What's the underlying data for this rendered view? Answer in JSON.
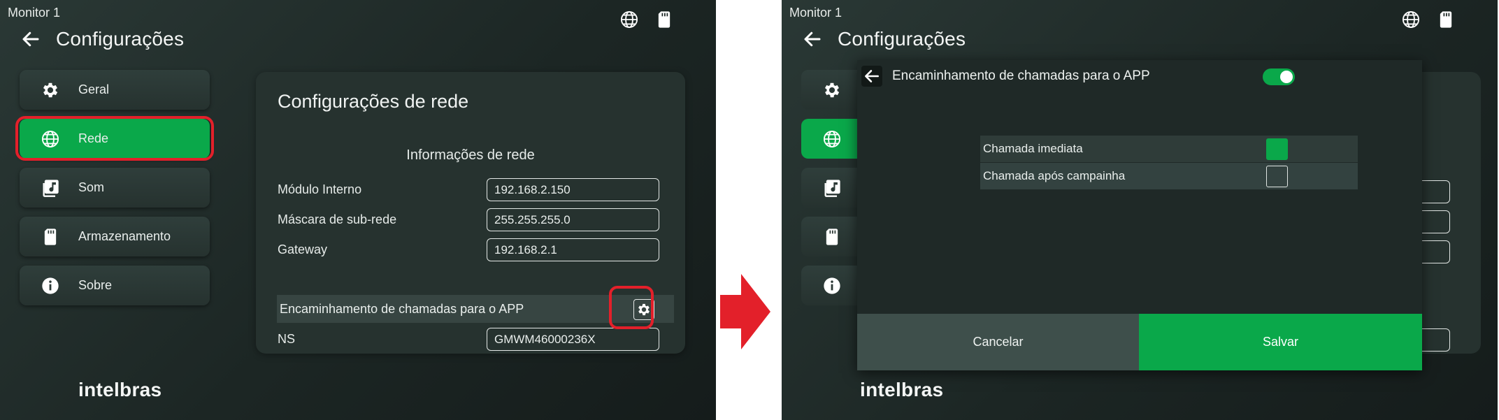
{
  "monitor_label": "Monitor 1",
  "page_title": "Configurações",
  "logo_text": "intelbras",
  "sidebar": {
    "items": [
      {
        "label": "Geral",
        "icon": "gear-icon"
      },
      {
        "label": "Rede",
        "icon": "globe-icon"
      },
      {
        "label": "Som",
        "icon": "music-icon"
      },
      {
        "label": "Armazenamento",
        "icon": "sd-card-icon"
      },
      {
        "label": "Sobre",
        "icon": "info-icon"
      }
    ],
    "active_index": 1
  },
  "network_panel": {
    "title": "Configurações de rede",
    "subtitle": "Informações de rede",
    "fields": [
      {
        "label": "Módulo Interno",
        "value": "192.168.2.150"
      },
      {
        "label": "Máscara de sub-rede",
        "value": "255.255.255.0"
      },
      {
        "label": "Gateway",
        "value": "192.168.2.1"
      }
    ],
    "forwarding_label": "Encaminhamento de chamadas para o APP",
    "ns_label": "NS",
    "ns_value": "GMWM46000236X"
  },
  "modal": {
    "title": "Encaminhamento de chamadas para o APP",
    "toggle_on": true,
    "options": [
      {
        "label": "Chamada imediata",
        "checked": true
      },
      {
        "label": "Chamada após campainha",
        "checked": false
      }
    ],
    "cancel_label": "Cancelar",
    "save_label": "Salvar"
  },
  "colors": {
    "accent_green": "#0aa84a",
    "highlight_red": "#e3202a",
    "background_dark": "#1c2624"
  }
}
